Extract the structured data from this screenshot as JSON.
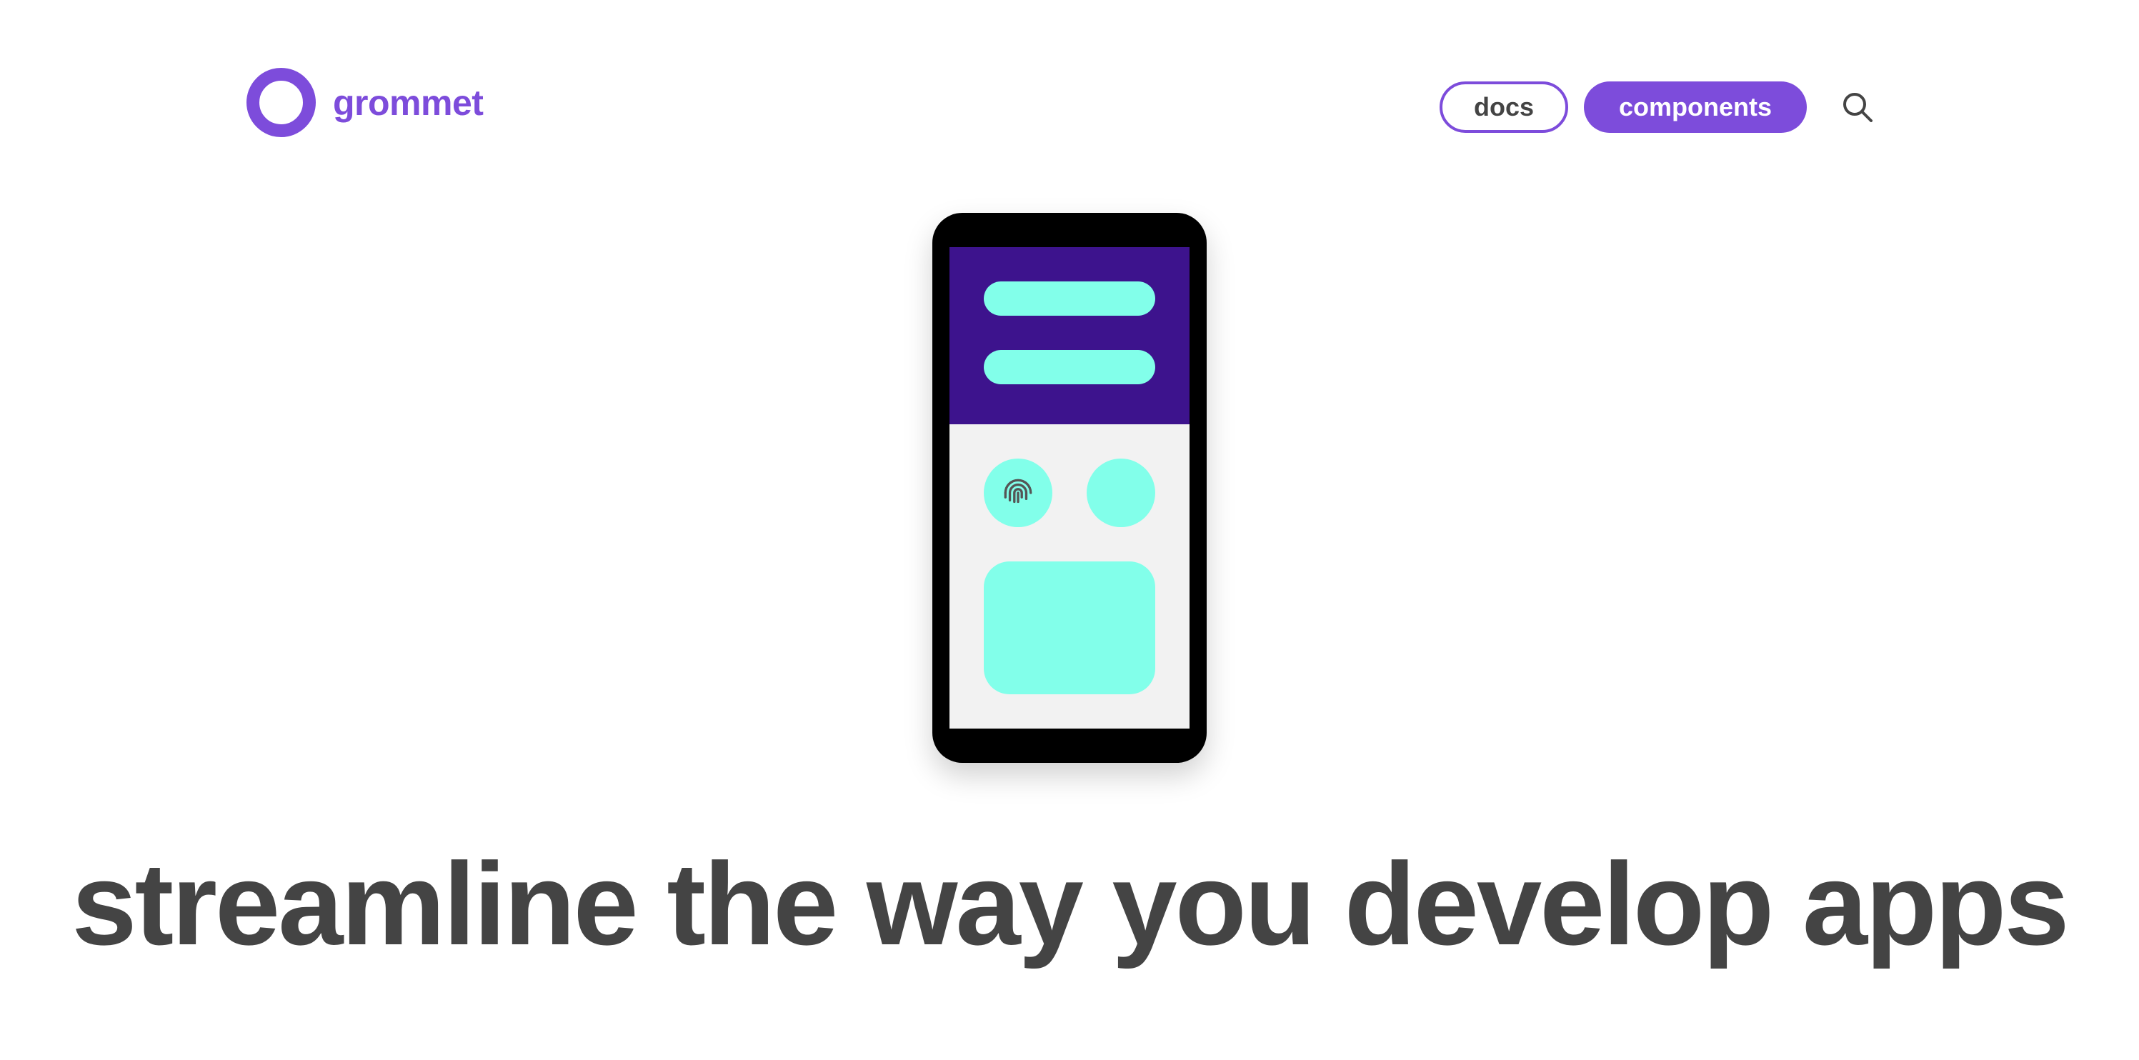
{
  "brand": {
    "name": "grommet",
    "accent": "#7D4CDB"
  },
  "nav": {
    "docs_label": "docs",
    "components_label": "components",
    "search_icon": "search-icon"
  },
  "illustration": {
    "header_color": "#3D138D",
    "element_color": "#82FFEA",
    "screen_color": "#F2F2F2",
    "icon": "fingerprint-icon"
  },
  "hero": {
    "headline": "streamline the way you develop apps"
  },
  "colors": {
    "text": "#444444",
    "background": "#FFFFFF"
  }
}
